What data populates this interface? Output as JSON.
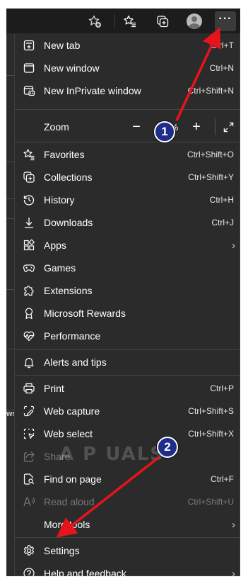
{
  "toolbar": {
    "add_favorite_icon": "star-plus-icon",
    "favorites_icon": "star-list-icon",
    "collections_icon": "collections-icon",
    "profile_icon": "avatar-icon",
    "more_label": "···"
  },
  "menu": {
    "items": [
      {
        "label": "New tab",
        "shortcut": "Ctrl+T",
        "icon": "new-tab-icon"
      },
      {
        "label": "New window",
        "shortcut": "Ctrl+N",
        "icon": "new-window-icon"
      },
      {
        "label": "New InPrivate window",
        "shortcut": "Ctrl+Shift+N",
        "icon": "inprivate-icon"
      },
      {
        "label": "Favorites",
        "shortcut": "Ctrl+Shift+O",
        "icon": "star-list-icon"
      },
      {
        "label": "Collections",
        "shortcut": "Ctrl+Shift+Y",
        "icon": "collections-icon"
      },
      {
        "label": "History",
        "shortcut": "Ctrl+H",
        "icon": "history-icon"
      },
      {
        "label": "Downloads",
        "shortcut": "Ctrl+J",
        "icon": "download-icon"
      },
      {
        "label": "Apps",
        "shortcut": "›",
        "icon": "apps-icon"
      },
      {
        "label": "Games",
        "shortcut": "",
        "icon": "games-icon"
      },
      {
        "label": "Extensions",
        "shortcut": "",
        "icon": "puzzle-icon"
      },
      {
        "label": "Microsoft Rewards",
        "shortcut": "",
        "icon": "rewards-icon"
      },
      {
        "label": "Performance",
        "shortcut": "",
        "icon": "performance-icon"
      },
      {
        "label": "Alerts and tips",
        "shortcut": "",
        "icon": "bell-icon"
      },
      {
        "label": "Print",
        "shortcut": "Ctrl+P",
        "icon": "printer-icon"
      },
      {
        "label": "Web capture",
        "shortcut": "Ctrl+Shift+S",
        "icon": "web-capture-icon"
      },
      {
        "label": "Web select",
        "shortcut": "Ctrl+Shift+X",
        "icon": "web-select-icon"
      },
      {
        "label": "Share",
        "shortcut": "",
        "icon": "share-icon"
      },
      {
        "label": "Find on page",
        "shortcut": "Ctrl+F",
        "icon": "find-icon"
      },
      {
        "label": "Read aloud",
        "shortcut": "Ctrl+Shift+U",
        "icon": "read-aloud-icon"
      },
      {
        "label": "More tools",
        "shortcut": "›",
        "icon": "more-tools-icon"
      },
      {
        "label": "Settings",
        "shortcut": "",
        "icon": "gear-icon"
      },
      {
        "label": "Help and feedback",
        "shortcut": "›",
        "icon": "help-icon"
      }
    ],
    "zoom": {
      "label": "Zoom",
      "minus": "−",
      "value": "100%",
      "plus": "+",
      "fullscreen_icon": "fullscreen-icon"
    }
  },
  "annotations": {
    "step1": "1",
    "step2": "2",
    "arrow_color": "#e8141b",
    "badge_color": "#1f2d8a"
  },
  "page_strip_text": "ws",
  "watermark": "A  P  UALS"
}
